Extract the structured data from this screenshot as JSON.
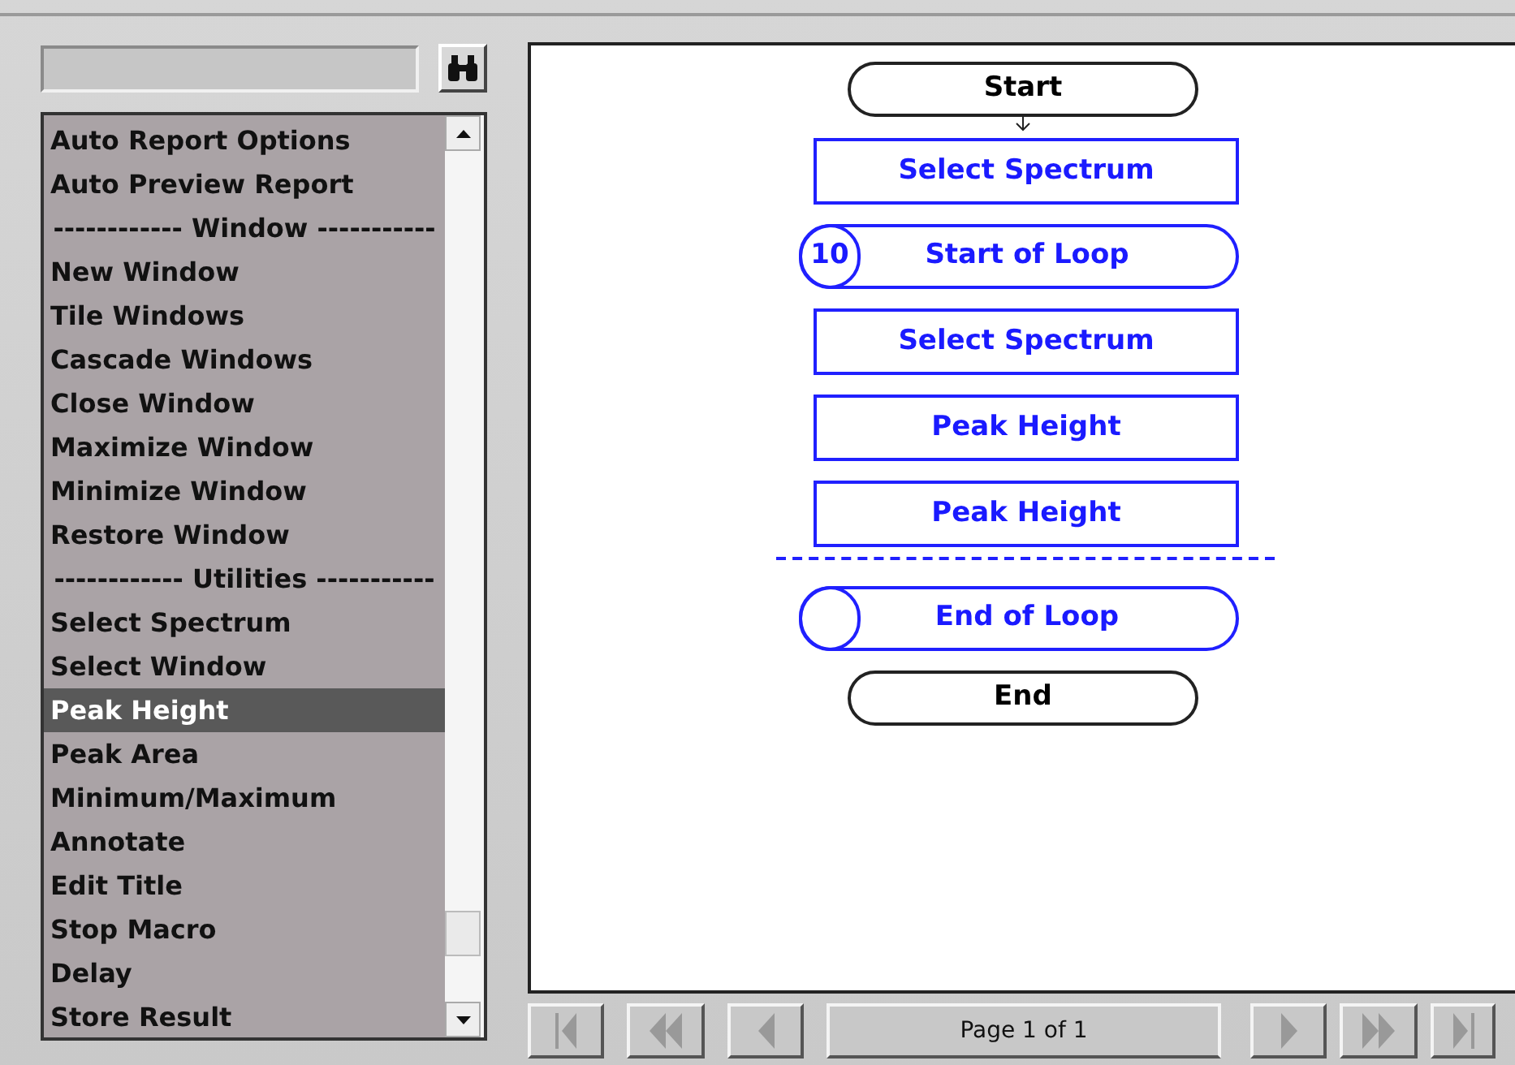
{
  "list": {
    "items": [
      {
        "kind": "item",
        "label": "Auto Report Options",
        "selected": false
      },
      {
        "kind": "item",
        "label": "Auto Preview Report",
        "selected": false
      },
      {
        "kind": "separator",
        "label": "------------  Window  -----------",
        "selected": false
      },
      {
        "kind": "item",
        "label": "New Window",
        "selected": false
      },
      {
        "kind": "item",
        "label": "Tile Windows",
        "selected": false
      },
      {
        "kind": "item",
        "label": "Cascade Windows",
        "selected": false
      },
      {
        "kind": "item",
        "label": "Close Window",
        "selected": false
      },
      {
        "kind": "item",
        "label": "Maximize Window",
        "selected": false
      },
      {
        "kind": "item",
        "label": "Minimize Window",
        "selected": false
      },
      {
        "kind": "item",
        "label": "Restore Window",
        "selected": false
      },
      {
        "kind": "separator",
        "label": "------------  Utilities  -----------",
        "selected": false
      },
      {
        "kind": "item",
        "label": "Select Spectrum",
        "selected": false
      },
      {
        "kind": "item",
        "label": "Select Window",
        "selected": false
      },
      {
        "kind": "item",
        "label": "Peak Height",
        "selected": true
      },
      {
        "kind": "item",
        "label": "Peak Area",
        "selected": false
      },
      {
        "kind": "item",
        "label": "Minimum/Maximum",
        "selected": false
      },
      {
        "kind": "item",
        "label": "Annotate",
        "selected": false
      },
      {
        "kind": "item",
        "label": "Edit Title",
        "selected": false
      },
      {
        "kind": "item",
        "label": "Stop Macro",
        "selected": false
      },
      {
        "kind": "item",
        "label": "Delay",
        "selected": false
      },
      {
        "kind": "item",
        "label": "Store Result",
        "selected": false
      }
    ]
  },
  "flowchart": {
    "nodes": [
      {
        "kind": "terminal",
        "label": "Start"
      },
      {
        "kind": "process",
        "label": "Select Spectrum"
      },
      {
        "kind": "loop",
        "label": "Start of Loop",
        "count": "10"
      },
      {
        "kind": "process",
        "label": "Select Spectrum"
      },
      {
        "kind": "process",
        "label": "Peak Height"
      },
      {
        "kind": "process",
        "label": "Peak Height"
      },
      {
        "kind": "insert-line"
      },
      {
        "kind": "loop",
        "label": "End of Loop"
      },
      {
        "kind": "terminal",
        "label": "End"
      }
    ]
  },
  "pager": {
    "label": "Page 1 of 1"
  }
}
